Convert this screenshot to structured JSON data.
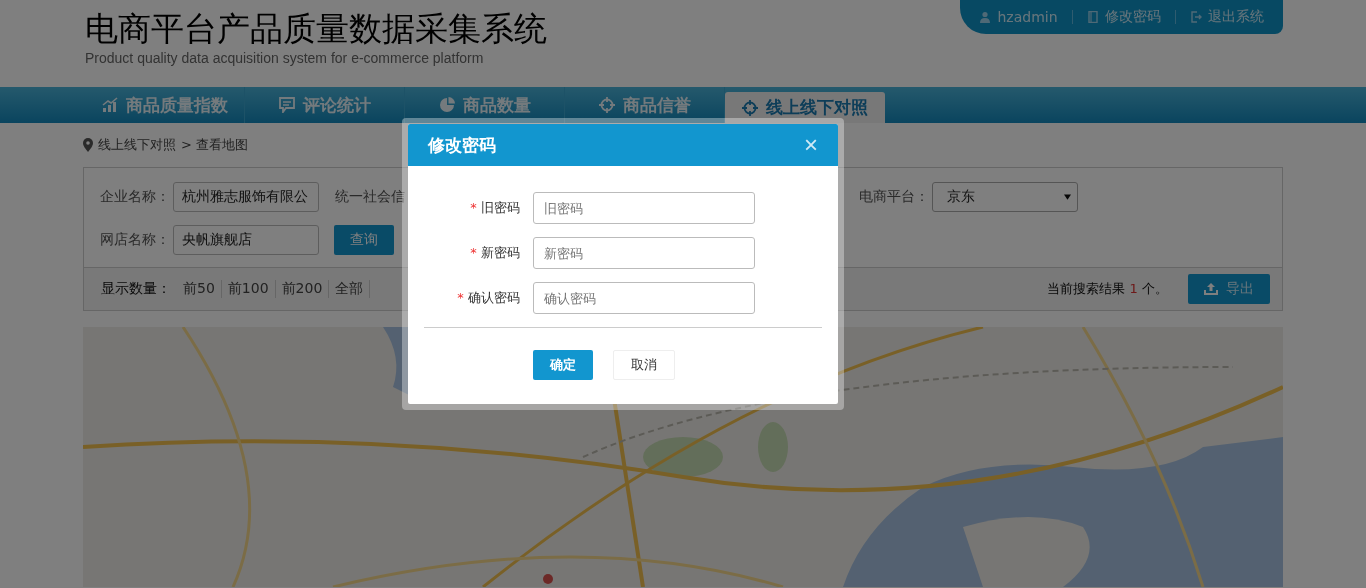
{
  "header": {
    "title": "电商平台产品质量数据采集系统",
    "subtitle": "Product quality data acquisition system for e-commerce platform"
  },
  "user_menu": [
    {
      "kind": "user",
      "label": "hzadmin"
    },
    {
      "kind": "password",
      "label": "修改密码"
    },
    {
      "kind": "logout",
      "label": "退出系统"
    }
  ],
  "tabs": [
    {
      "kind": "chart",
      "label": "商品质量指数",
      "selected": false
    },
    {
      "kind": "comment",
      "label": "评论统计",
      "selected": false
    },
    {
      "kind": "pie",
      "label": "商品数量",
      "selected": false
    },
    {
      "kind": "target",
      "label": "商品信誉",
      "selected": false
    },
    {
      "kind": "target",
      "label": "线上线下对照",
      "selected": true
    }
  ],
  "breadcrumb": {
    "path": "线上线下对照",
    "current": "> 查看地图"
  },
  "filters": {
    "company_label": "企业名称：",
    "company_value": "杭州雅志服饰有限公",
    "credit_label": "统一社会信",
    "platform_label": "电商平台：",
    "platform_value": "京东",
    "shop_label": "网店名称：",
    "shop_value": "央帆旗舰店",
    "query_button": "查询"
  },
  "result_bar": {
    "count_label": "显示数量：",
    "count_options": [
      "前50",
      "前100",
      "前200",
      "全部"
    ],
    "result_prefix": "当前搜索结果",
    "result_count": "1",
    "result_suffix": "个。",
    "export_button": "导出"
  },
  "dialog": {
    "title": "修改密码",
    "close": "×",
    "fields": [
      {
        "label": "旧密码",
        "placeholder": "旧密码",
        "required": true
      },
      {
        "label": "新密码",
        "placeholder": "新密码",
        "required": true
      },
      {
        "label": "确认密码",
        "placeholder": "确认密码",
        "required": true
      }
    ],
    "required_mark": "*",
    "confirm_button": "确定",
    "cancel_button": "取消"
  }
}
